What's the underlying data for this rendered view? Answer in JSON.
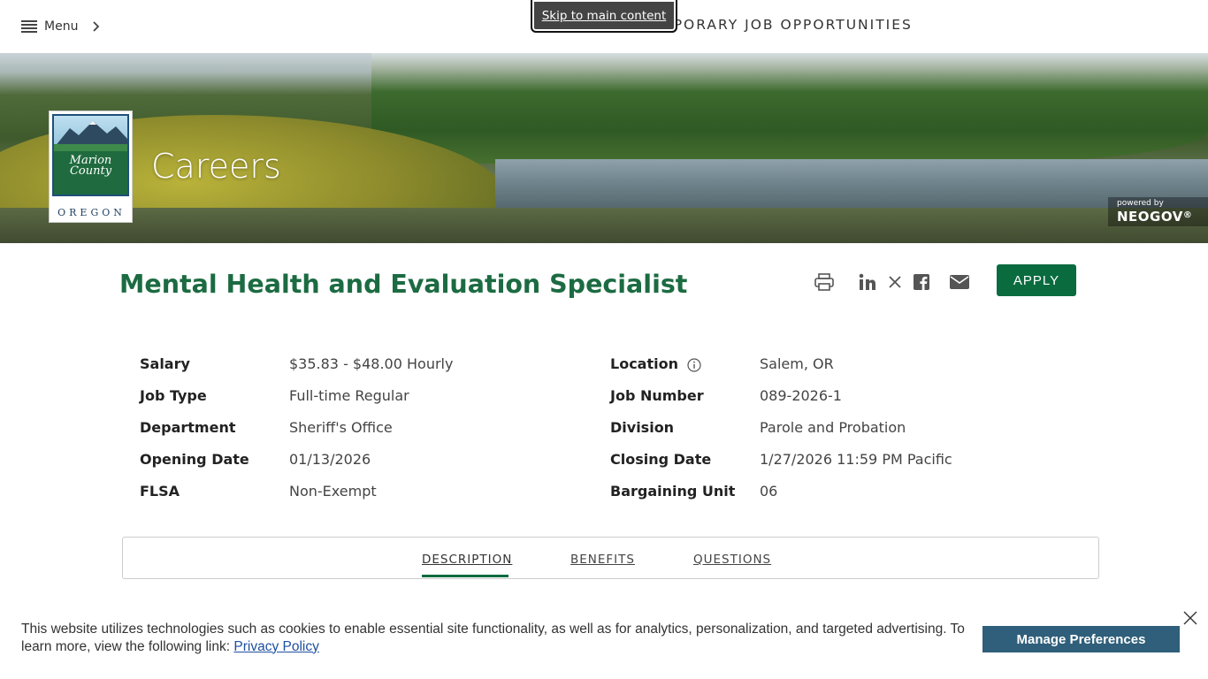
{
  "header": {
    "menu_label": "Menu",
    "skip_link": "Skip to main content",
    "heading": "AND TEMPORARY JOB OPPORTUNITIES"
  },
  "banner": {
    "title": "Careers",
    "logo_text_1": "Marion",
    "logo_text_2": "County",
    "logo_state": "OREGON",
    "powered_by": "powered by",
    "powered_brand": "NEOGOV"
  },
  "job": {
    "title": "Mental Health and Evaluation Specialist",
    "apply_label": "APPLY",
    "share_icons": [
      "print-icon",
      "linkedin-icon",
      "x-icon",
      "facebook-icon",
      "email-icon"
    ]
  },
  "details": {
    "left": [
      {
        "label": "Salary",
        "value": "$35.83 - $48.00 Hourly"
      },
      {
        "label": "Job Type",
        "value": "Full-time Regular"
      },
      {
        "label": "Department",
        "value": "Sheriff's Office"
      },
      {
        "label": "Opening Date",
        "value": "01/13/2026"
      },
      {
        "label": "FLSA",
        "value": "Non-Exempt"
      }
    ],
    "right": [
      {
        "label": "Location",
        "value": "Salem, OR"
      },
      {
        "label": "Job Number",
        "value": "089-2026-1"
      },
      {
        "label": "Division",
        "value": "Parole and Probation"
      },
      {
        "label": "Closing Date",
        "value": "1/27/2026 11:59 PM Pacific"
      },
      {
        "label": "Bargaining Unit",
        "value": "06"
      }
    ]
  },
  "tabs": [
    {
      "label": "DESCRIPTION",
      "active": true
    },
    {
      "label": "BENEFITS",
      "active": false
    },
    {
      "label": "QUESTIONS",
      "active": false
    }
  ],
  "cookie": {
    "text": "This website utilizes technologies such as cookies to enable essential site functionality, as well as for analytics, personalization, and targeted advertising. To learn more, view the following link:",
    "link_label": "Privacy Policy",
    "manage_label": "Manage Preferences"
  },
  "colors": {
    "brand_green": "#0a6b3f",
    "title_green": "#1c6b42",
    "cookie_button": "#2f5f7a"
  }
}
